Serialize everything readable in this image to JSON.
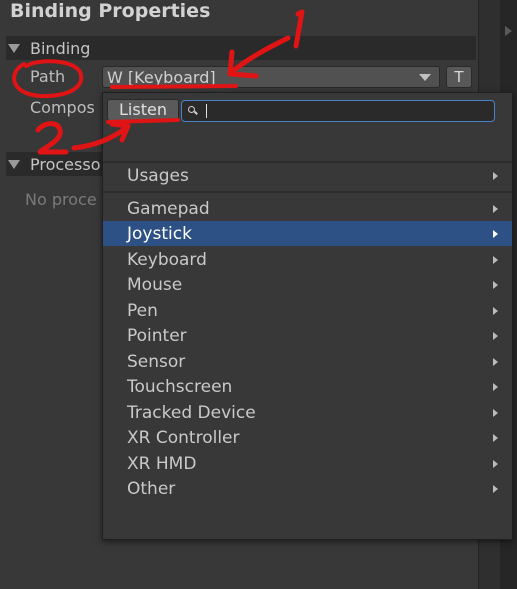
{
  "panel": {
    "title": "Binding Properties",
    "binding_section": "Binding",
    "path_label": "Path",
    "path_value": "W [Keyboard]",
    "t_button": "T",
    "composite_label": "Compos",
    "processors_section": "Processo",
    "no_processors": "No proce"
  },
  "dropdown": {
    "listen_label": "Listen",
    "search_value": "",
    "items": [
      {
        "label": "Usages"
      },
      {
        "label": "Gamepad"
      },
      {
        "label": "Joystick"
      },
      {
        "label": "Keyboard"
      },
      {
        "label": "Mouse"
      },
      {
        "label": "Pen"
      },
      {
        "label": "Pointer"
      },
      {
        "label": "Sensor"
      },
      {
        "label": "Touchscreen"
      },
      {
        "label": "Tracked Device"
      },
      {
        "label": "XR Controller"
      },
      {
        "label": "XR HMD"
      },
      {
        "label": "Other"
      }
    ],
    "selected": "Joystick"
  },
  "annotations": {
    "mark_1": "1",
    "mark_2": "2",
    "color": "#e01414"
  },
  "colors": {
    "selection": "#2d5185",
    "search_focus": "#4a82c8",
    "background": "#383838"
  }
}
